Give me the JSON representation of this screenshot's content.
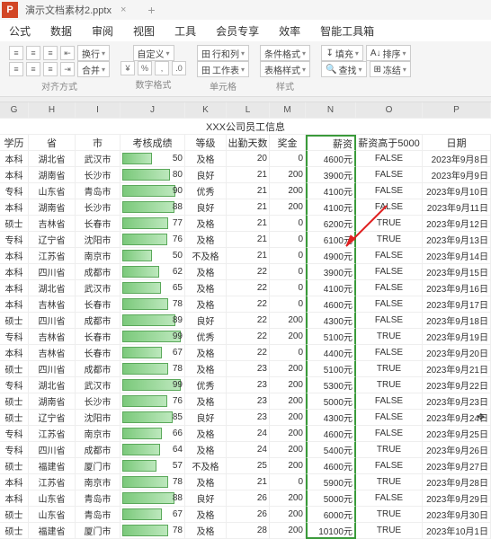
{
  "titlebar": {
    "badge": "P",
    "docName": "演示文档素材2.pptx"
  },
  "menubar": [
    "公式",
    "数据",
    "审阅",
    "视图",
    "工具",
    "会员专享",
    "效率",
    "智能工具箱"
  ],
  "ribbon": {
    "align_group": "对齐方式",
    "num_group": "数字格式",
    "cell_group": "单元格",
    "style_group": "样式",
    "wrap": "换行",
    "custom": "自定义",
    "rowcol": "行和列",
    "cond": "条件格式",
    "fill": "填充",
    "sort": "排序",
    "merge": "合并",
    "workbook": "工作表",
    "cellstyle": "表格样式",
    "find": "查找",
    "freeze": "冻结"
  },
  "cols": [
    "G",
    "H",
    "I",
    "J",
    "K",
    "L",
    "M",
    "N",
    "O",
    "P"
  ],
  "title": "XXX公司员工信息",
  "headers": [
    "学历",
    "省",
    "市",
    "考核成绩",
    "等级",
    "出勤天数",
    "奖金",
    "薪资",
    "薪资高于5000",
    "日期"
  ],
  "rows": [
    {
      "edu": "本科",
      "prov": "湖北省",
      "city": "武汉市",
      "score": 50,
      "grade": "及格",
      "days": 20,
      "bonus": 0,
      "salary": "4600元",
      "gt": "FALSE",
      "date": "2023年9月8日"
    },
    {
      "edu": "本科",
      "prov": "湖南省",
      "city": "长沙市",
      "score": 80,
      "grade": "良好",
      "days": 21,
      "bonus": 200,
      "salary": "3900元",
      "gt": "FALSE",
      "date": "2023年9月9日"
    },
    {
      "edu": "专科",
      "prov": "山东省",
      "city": "青岛市",
      "score": 90,
      "grade": "优秀",
      "days": 21,
      "bonus": 200,
      "salary": "4100元",
      "gt": "FALSE",
      "date": "2023年9月10日"
    },
    {
      "edu": "本科",
      "prov": "湖南省",
      "city": "长沙市",
      "score": 88,
      "grade": "良好",
      "days": 21,
      "bonus": 200,
      "salary": "4100元",
      "gt": "FALSE",
      "date": "2023年9月11日"
    },
    {
      "edu": "硕士",
      "prov": "吉林省",
      "city": "长春市",
      "score": 77,
      "grade": "及格",
      "days": 21,
      "bonus": 0,
      "salary": "6200元",
      "gt": "TRUE",
      "date": "2023年9月12日"
    },
    {
      "edu": "专科",
      "prov": "辽宁省",
      "city": "沈阳市",
      "score": 76,
      "grade": "及格",
      "days": 21,
      "bonus": 0,
      "salary": "6100元",
      "gt": "TRUE",
      "date": "2023年9月13日"
    },
    {
      "edu": "本科",
      "prov": "江苏省",
      "city": "南京市",
      "score": 50,
      "grade": "不及格",
      "days": 21,
      "bonus": 0,
      "salary": "4900元",
      "gt": "FALSE",
      "date": "2023年9月14日"
    },
    {
      "edu": "本科",
      "prov": "四川省",
      "city": "成都市",
      "score": 62,
      "grade": "及格",
      "days": 22,
      "bonus": 0,
      "salary": "3900元",
      "gt": "FALSE",
      "date": "2023年9月15日"
    },
    {
      "edu": "本科",
      "prov": "湖北省",
      "city": "武汉市",
      "score": 65,
      "grade": "及格",
      "days": 22,
      "bonus": 0,
      "salary": "4100元",
      "gt": "FALSE",
      "date": "2023年9月16日"
    },
    {
      "edu": "本科",
      "prov": "吉林省",
      "city": "长春市",
      "score": 78,
      "grade": "及格",
      "days": 22,
      "bonus": 0,
      "salary": "4600元",
      "gt": "FALSE",
      "date": "2023年9月17日"
    },
    {
      "edu": "硕士",
      "prov": "四川省",
      "city": "成都市",
      "score": 89,
      "grade": "良好",
      "days": 22,
      "bonus": 200,
      "salary": "4300元",
      "gt": "FALSE",
      "date": "2023年9月18日"
    },
    {
      "edu": "专科",
      "prov": "吉林省",
      "city": "长春市",
      "score": 99,
      "grade": "优秀",
      "days": 22,
      "bonus": 200,
      "salary": "5100元",
      "gt": "TRUE",
      "date": "2023年9月19日"
    },
    {
      "edu": "本科",
      "prov": "吉林省",
      "city": "长春市",
      "score": 67,
      "grade": "及格",
      "days": 22,
      "bonus": 0,
      "salary": "4400元",
      "gt": "FALSE",
      "date": "2023年9月20日"
    },
    {
      "edu": "硕士",
      "prov": "四川省",
      "city": "成都市",
      "score": 78,
      "grade": "及格",
      "days": 23,
      "bonus": 200,
      "salary": "5100元",
      "gt": "TRUE",
      "date": "2023年9月21日"
    },
    {
      "edu": "专科",
      "prov": "湖北省",
      "city": "武汉市",
      "score": 99,
      "grade": "优秀",
      "days": 23,
      "bonus": 200,
      "salary": "5300元",
      "gt": "TRUE",
      "date": "2023年9月22日"
    },
    {
      "edu": "硕士",
      "prov": "湖南省",
      "city": "长沙市",
      "score": 76,
      "grade": "及格",
      "days": 23,
      "bonus": 200,
      "salary": "5000元",
      "gt": "FALSE",
      "date": "2023年9月23日"
    },
    {
      "edu": "硕士",
      "prov": "辽宁省",
      "city": "沈阳市",
      "score": 85,
      "grade": "良好",
      "days": 23,
      "bonus": 200,
      "salary": "4300元",
      "gt": "FALSE",
      "date": "2023年9月24日",
      "cursor": true
    },
    {
      "edu": "专科",
      "prov": "江苏省",
      "city": "南京市",
      "score": 66,
      "grade": "及格",
      "days": 24,
      "bonus": 200,
      "salary": "4600元",
      "gt": "FALSE",
      "date": "2023年9月25日"
    },
    {
      "edu": "专科",
      "prov": "四川省",
      "city": "成都市",
      "score": 64,
      "grade": "及格",
      "days": 24,
      "bonus": 200,
      "salary": "5400元",
      "gt": "TRUE",
      "date": "2023年9月26日"
    },
    {
      "edu": "硕士",
      "prov": "福建省",
      "city": "厦门市",
      "score": 57,
      "grade": "不及格",
      "days": 25,
      "bonus": 200,
      "salary": "4600元",
      "gt": "FALSE",
      "date": "2023年9月27日"
    },
    {
      "edu": "本科",
      "prov": "江苏省",
      "city": "南京市",
      "score": 78,
      "grade": "及格",
      "days": 21,
      "bonus": 0,
      "salary": "5900元",
      "gt": "TRUE",
      "date": "2023年9月28日"
    },
    {
      "edu": "本科",
      "prov": "山东省",
      "city": "青岛市",
      "score": 88,
      "grade": "良好",
      "days": 26,
      "bonus": 200,
      "salary": "5000元",
      "gt": "FALSE",
      "date": "2023年9月29日"
    },
    {
      "edu": "硕士",
      "prov": "山东省",
      "city": "青岛市",
      "score": 67,
      "grade": "及格",
      "days": 26,
      "bonus": 200,
      "salary": "6000元",
      "gt": "TRUE",
      "date": "2023年9月30日"
    },
    {
      "edu": "硕士",
      "prov": "福建省",
      "city": "厦门市",
      "score": 78,
      "grade": "及格",
      "days": 28,
      "bonus": 200,
      "salary": "10100元",
      "gt": "TRUE",
      "date": "2023年10月1日"
    }
  ]
}
